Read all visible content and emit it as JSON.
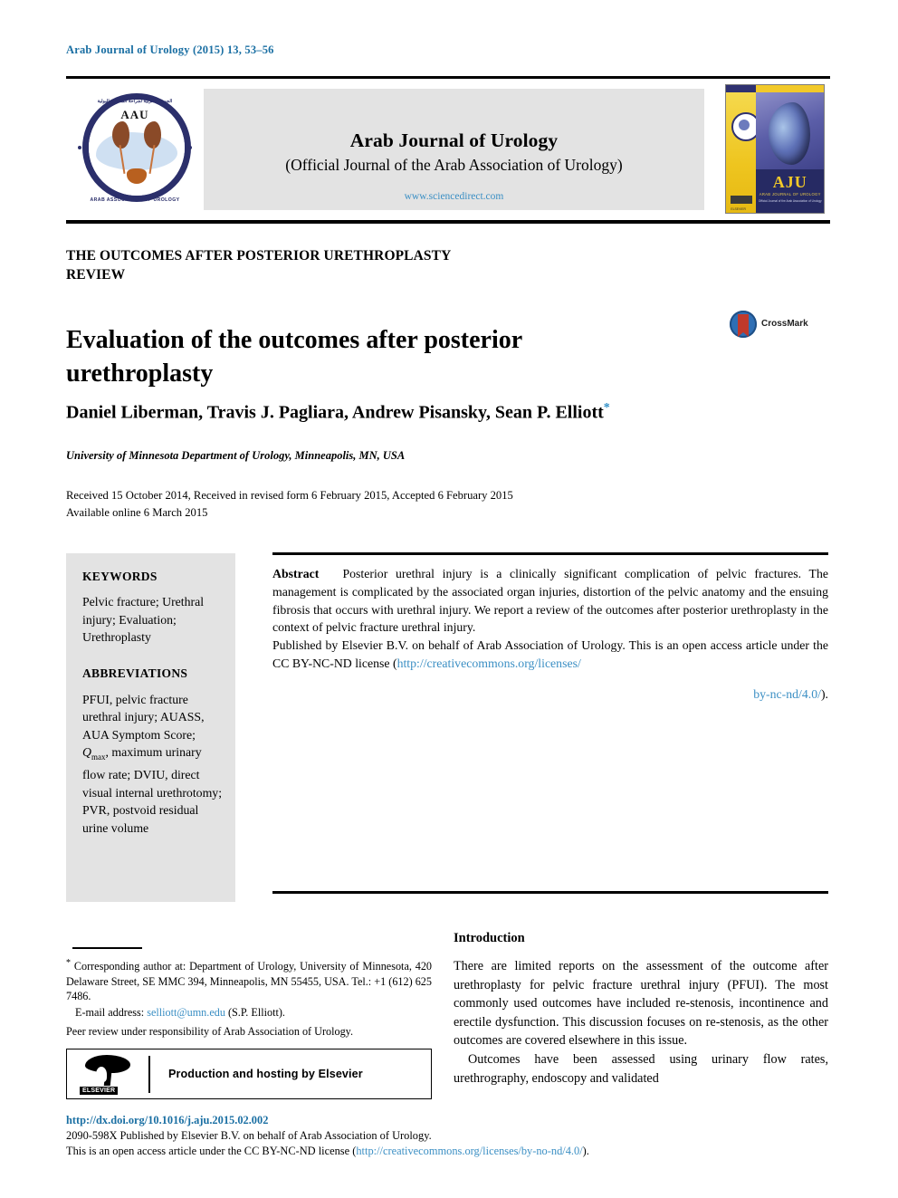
{
  "running_head": "Arab Journal of Urology (2015) 13, 53–56",
  "masthead": {
    "logo_text": "AAU",
    "logo_rim_top": "الجمعية العربية لجراحة المسالك البولية",
    "logo_rim_bottom": "ARAB ASSOCIATION OF UROLOGY",
    "journal_title": "Arab Journal of Urology",
    "journal_subtitle": "(Official Journal of the Arab Association of Urology)",
    "sciencedirect_link": "www.sciencedirect.com",
    "cover": {
      "acronym": "AJU",
      "sub1": "ARAB JOURNAL OF UROLOGY",
      "sub2": "Official Journal of the Arab Association of Urology",
      "publisher": "ELSEVIER"
    }
  },
  "article": {
    "section_header_line1": "THE OUTCOMES AFTER POSTERIOR URETHROPLASTY",
    "section_header_line2": "REVIEW",
    "title": "Evaluation of the outcomes after posterior urethroplasty",
    "crossmark_label": "CrossMark",
    "authors": "Daniel Liberman, Travis J. Pagliara, Andrew Pisansky, Sean P. Elliott",
    "author_footnote_marker": "*",
    "affiliation": "University of Minnesota Department of Urology, Minneapolis, MN, USA",
    "dates_line1": "Received 15 October 2014, Received in revised form 6 February 2015, Accepted 6 February 2015",
    "dates_line2": "Available online 6 March 2015"
  },
  "keywords_panel": {
    "keywords_heading": "KEYWORDS",
    "keywords": "Pelvic fracture; Urethral injury; Evaluation; Urethroplasty",
    "abbreviations_heading": "ABBREVIATIONS",
    "abbreviations_part1": "PFUI, pelvic fracture urethral injury; AUASS, AUA Symptom Score; ",
    "abbreviations_qmax_symbol": "Q",
    "abbreviations_qmax_sub": "max",
    "abbreviations_part2": ", maximum urinary flow rate; DVIU, direct visual internal urethrotomy; PVR, postvoid residual urine volume"
  },
  "abstract": {
    "label": "Abstract",
    "body": "Posterior urethral injury is a clinically significant complication of pelvic fractures. The management is complicated by the associated organ injuries, distortion of the pelvic anatomy and the ensuing fibrosis that occurs with urethral injury. We report a review of the outcomes after posterior urethroplasty in the context of pelvic fracture urethral injury.",
    "license_lead": "Published by Elsevier B.V. on behalf of Arab Association of Urology. This is an open access article under the CC BY-NC-ND license (",
    "license_url_line1": "http://creativecommons.org/licenses/",
    "license_url_line2": "by-nc-nd/4.0/",
    "license_tail": ")."
  },
  "footnote": {
    "marker": "*",
    "corresponding": "Corresponding author at: Department of Urology, University of Minnesota, 420 Delaware Street, SE MMC 394, Minneapolis, MN 55455, USA. Tel.: +1 (612) 625 7486.",
    "email_label": "E-mail address:",
    "email": "selliott@umn.edu",
    "email_owner": "(S.P. Elliott).",
    "peer_review": "Peer review under responsibility of Arab Association of Urology."
  },
  "elsevier_box": {
    "logo_word": "ELSEVIER",
    "label": "Production and hosting by Elsevier"
  },
  "footer": {
    "doi": "http://dx.doi.org/10.1016/j.aju.2015.02.002",
    "issn_line": "2090-598X Published by Elsevier B.V. on behalf of Arab Association of Urology.",
    "license_lead": "This is an open access article under the CC BY-NC-ND license (",
    "license_url": "http://creativecommons.org/licenses/by-no-nd/4.0/",
    "license_tail": ")."
  },
  "main": {
    "intro_heading": "Introduction",
    "intro_p1": "There are limited reports on the assessment of the outcome after urethroplasty for pelvic fracture urethral injury (PFUI). The most commonly used outcomes have included re-stenosis, incontinence and erectile dysfunction. This discussion focuses on re-stenosis, as the other outcomes are covered elsewhere in this issue.",
    "intro_p2": "Outcomes have been assessed using urinary flow rates, urethrography, endoscopy and validated"
  },
  "colors": {
    "link": "#3b8fc4",
    "running_head": "#1a6fa3",
    "panel_bg": "#e3e3e3",
    "logo_navy": "#2b2f6b",
    "cover_yellow": "#f2c929"
  }
}
